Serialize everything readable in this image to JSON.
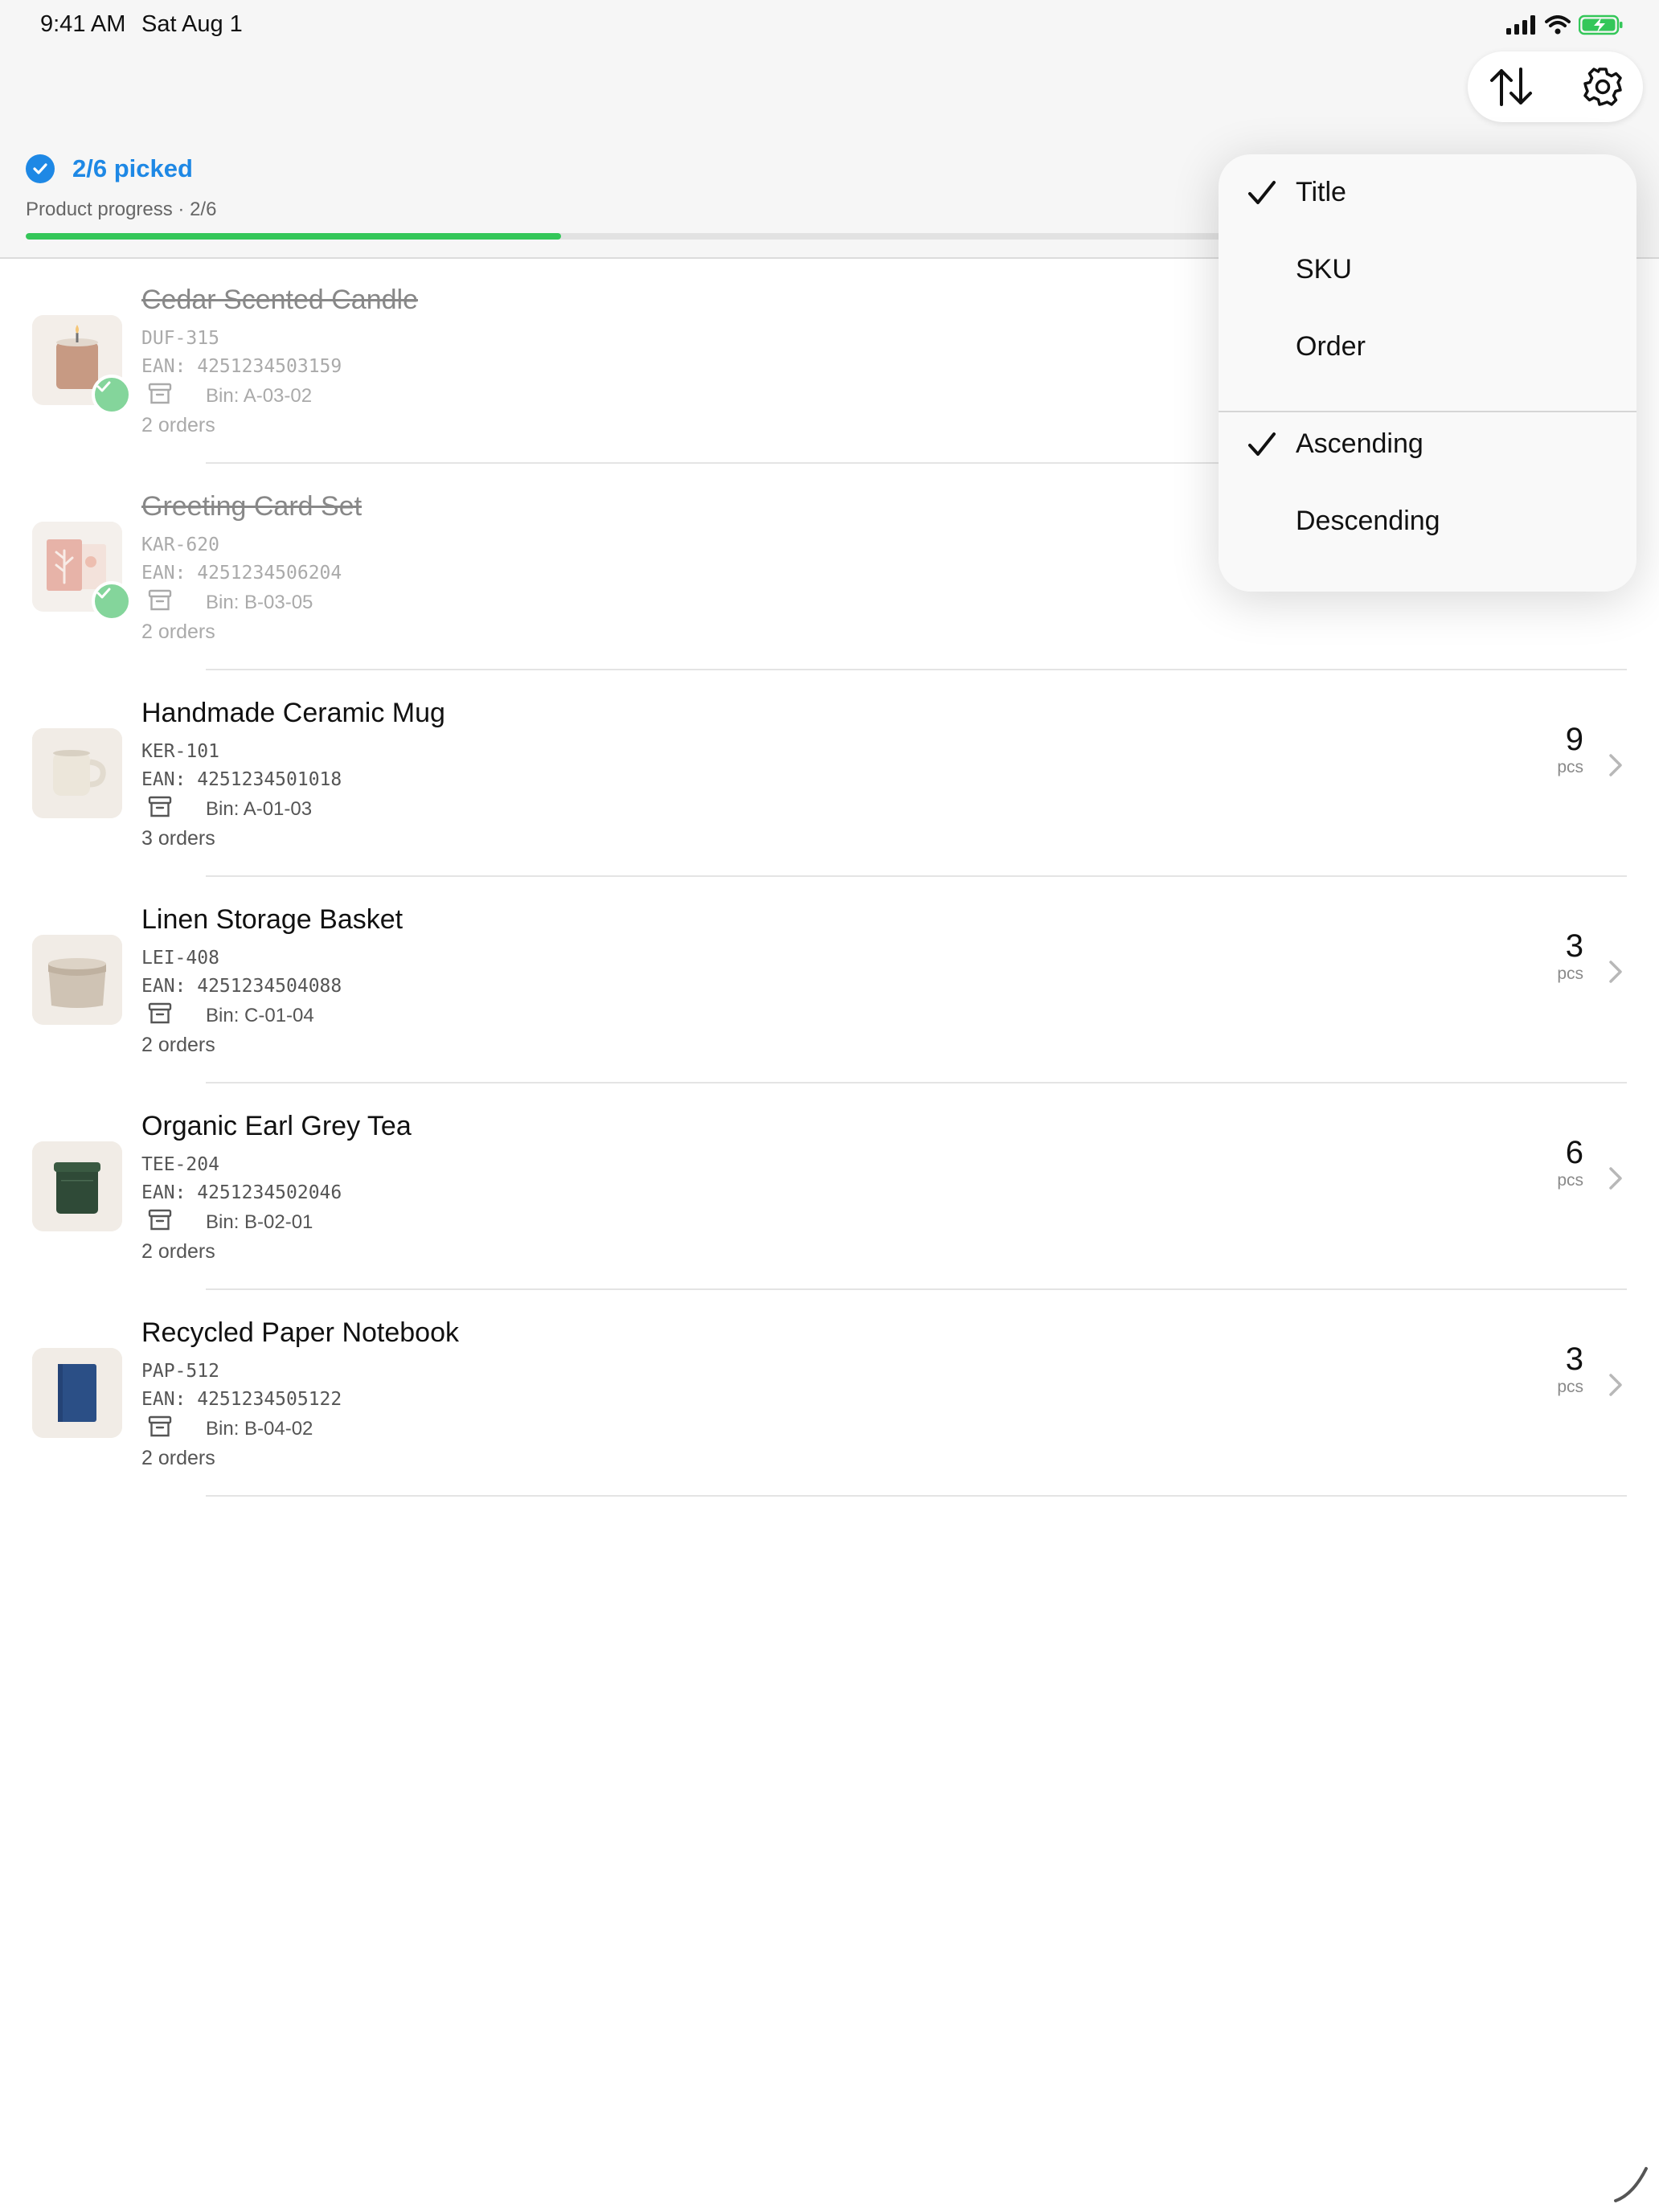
{
  "status_bar": {
    "time": "9:41 AM",
    "date": "Sat Aug 1"
  },
  "toolbar": {
    "sort_icon": "arrow-up-down-icon",
    "settings_icon": "gear-icon"
  },
  "progress": {
    "picked_label": "2/6 picked",
    "text": "Product progress · 2/6",
    "fraction": 0.333
  },
  "sort_menu": {
    "sort_by": [
      {
        "label": "Title",
        "checked": true
      },
      {
        "label": "SKU",
        "checked": false
      },
      {
        "label": "Order",
        "checked": false
      }
    ],
    "direction": [
      {
        "label": "Ascending",
        "checked": true
      },
      {
        "label": "Descending",
        "checked": false
      }
    ]
  },
  "products": [
    {
      "title": "Cedar Scented Candle",
      "sku": "DUF-315",
      "ean": "EAN: 4251234503159",
      "bin": "Bin: A-03-02",
      "orders": "2 orders",
      "picked": true,
      "qty": "",
      "unit": ""
    },
    {
      "title": "Greeting Card Set",
      "sku": "KAR-620",
      "ean": "EAN: 4251234506204",
      "bin": "Bin: B-03-05",
      "orders": "2 orders",
      "picked": true,
      "qty": "",
      "unit": ""
    },
    {
      "title": "Handmade Ceramic Mug",
      "sku": "KER-101",
      "ean": "EAN: 4251234501018",
      "bin": "Bin: A-01-03",
      "orders": "3 orders",
      "picked": false,
      "qty": "9",
      "unit": "pcs"
    },
    {
      "title": "Linen Storage Basket",
      "sku": "LEI-408",
      "ean": "EAN: 4251234504088",
      "bin": "Bin: C-01-04",
      "orders": "2 orders",
      "picked": false,
      "qty": "3",
      "unit": "pcs"
    },
    {
      "title": "Organic Earl Grey Tea",
      "sku": "TEE-204",
      "ean": "EAN: 4251234502046",
      "bin": "Bin: B-02-01",
      "orders": "2 orders",
      "picked": false,
      "qty": "6",
      "unit": "pcs"
    },
    {
      "title": "Recycled Paper Notebook",
      "sku": "PAP-512",
      "ean": "EAN: 4251234505122",
      "bin": "Bin: B-04-02",
      "orders": "2 orders",
      "picked": false,
      "qty": "3",
      "unit": "pcs"
    }
  ],
  "colors": {
    "accent": "#1e88e5",
    "progress": "#34c759",
    "picked_badge": "#5cc77a"
  }
}
